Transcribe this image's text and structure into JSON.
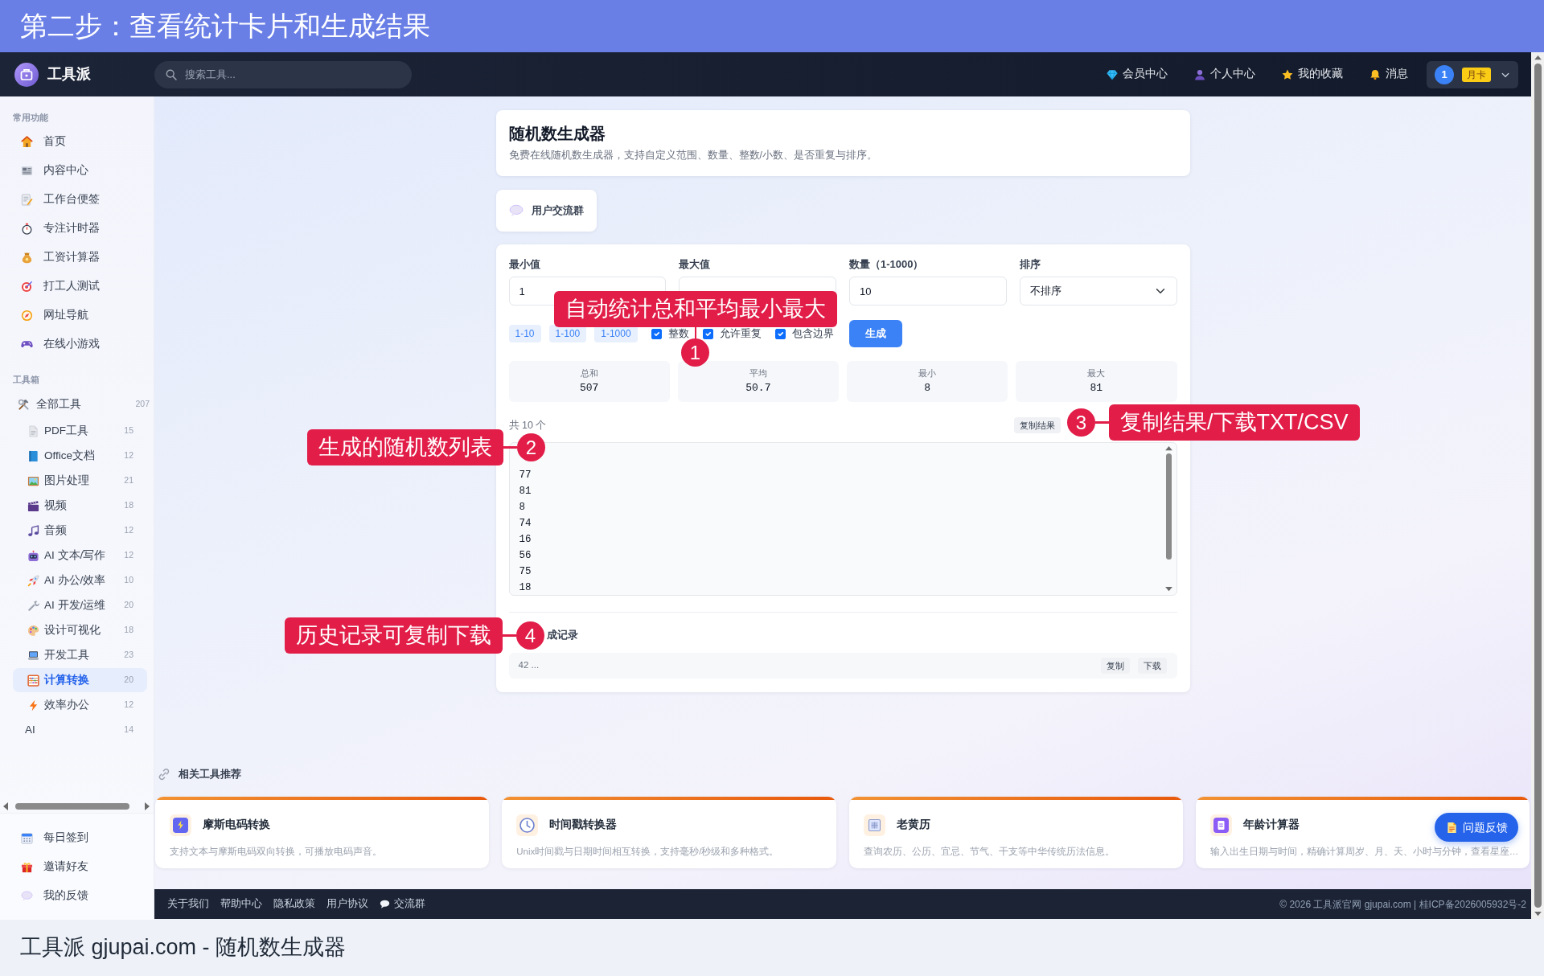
{
  "banner": {
    "title": "第二步：查看统计卡片和生成结果"
  },
  "navbar": {
    "brand": "工具派",
    "search": {
      "placeholder": "搜索工具..."
    },
    "links": [
      "会员中心",
      "个人中心",
      "我的收藏",
      "消息"
    ],
    "user": {
      "avatar": "1",
      "badge": "月卡"
    }
  },
  "sidebar": {
    "sections": [
      {
        "title": "常用功能",
        "items": [
          {
            "label": "首页",
            "selected": false
          },
          {
            "label": "内容中心",
            "selected": false
          },
          {
            "label": "工作台便签",
            "selected": false
          },
          {
            "label": "专注计时器",
            "selected": false
          },
          {
            "label": "工资计算器",
            "selected": false
          },
          {
            "label": "打工人测试",
            "selected": false
          },
          {
            "label": "网址导航",
            "selected": false
          },
          {
            "label": "在线小游戏",
            "selected": false
          }
        ]
      },
      {
        "title": "工具箱",
        "items": [
          {
            "label": "全部工具",
            "count": "207",
            "selected": false,
            "children": [
              {
                "label": "PDF工具",
                "count": "15",
                "selected": false
              },
              {
                "label": "Office文档",
                "count": "12",
                "selected": false
              },
              {
                "label": "图片处理",
                "count": "21",
                "selected": false
              },
              {
                "label": "视频",
                "count": "18",
                "selected": false
              },
              {
                "label": "音频",
                "count": "12",
                "selected": false
              },
              {
                "label": "AI 文本/写作",
                "count": "12",
                "selected": false
              },
              {
                "label": "AI 办公/效率",
                "count": "10",
                "selected": false
              },
              {
                "label": "AI 开发/运维",
                "count": "20",
                "selected": false
              },
              {
                "label": "设计可视化",
                "count": "18",
                "selected": false
              },
              {
                "label": "开发工具",
                "count": "23",
                "selected": false
              },
              {
                "label": "计算转换",
                "count": "20",
                "selected": true
              },
              {
                "label": "效率办公",
                "count": "12",
                "selected": false
              },
              {
                "label": "AI",
                "count": "14",
                "selected": false
              }
            ]
          }
        ]
      }
    ],
    "footer_items": [
      {
        "label": "每日签到",
        "selected": false
      },
      {
        "label": "邀请好友",
        "selected": false
      },
      {
        "label": "我的反馈",
        "selected": false
      }
    ]
  },
  "tool": {
    "title": "随机数生成器",
    "description": "免费在线随机数生成器，支持自定义范围、数量、整数/小数、是否重复与排序。"
  },
  "community": {
    "label": "用户交流群"
  },
  "form": {
    "fields": [
      {
        "label": "最小值",
        "kind": "input",
        "value": "1"
      },
      {
        "label": "最大值",
        "kind": "input"
      },
      {
        "label": "数量（1-1000）",
        "kind": "input",
        "value": "10"
      },
      {
        "label": "排序",
        "kind": "select",
        "value": "不排序"
      }
    ],
    "presets": [
      "1-10",
      "1-100",
      "1-1000"
    ],
    "options": [
      {
        "label": "整数",
        "checked": true
      },
      {
        "label": "允许重复",
        "checked": true
      },
      {
        "label": "包含边界",
        "checked": true
      }
    ],
    "submit": "生成"
  },
  "stats": [
    {
      "label": "总和",
      "value": "507"
    },
    {
      "label": "平均",
      "value": "50.7"
    },
    {
      "label": "最小",
      "value": "8"
    },
    {
      "label": "最大",
      "value": "81"
    }
  ],
  "results": {
    "summary": "共 10 个",
    "actions": [
      "复制结果"
    ],
    "values": [
      "77",
      "81",
      "8",
      "74",
      "16",
      "56",
      "75",
      "18"
    ]
  },
  "history": {
    "title": "成记录",
    "entries": [
      {
        "text": "42 ...",
        "actions": [
          "复制",
          "下载"
        ]
      }
    ]
  },
  "related": {
    "title": "相关工具推荐",
    "cards": [
      {
        "title": "摩斯电码转换",
        "description": "支持文本与摩斯电码双向转换，可播放电码声音。"
      },
      {
        "title": "时间戳转换器",
        "description": "Unix时间戳与日期时间相互转换，支持毫秒/秒级和多种格式。"
      },
      {
        "title": "老黄历",
        "description": "查询农历、公历、宜忌、节气、干支等中华传统历法信息。"
      },
      {
        "title": "年龄计算器",
        "description": "输入出生日期与时间，精确计算周岁、月、天、小时与分钟，查看星座…"
      }
    ]
  },
  "feedback_button": "问题反馈",
  "footer": {
    "links": [
      "关于我们",
      "帮助中心",
      "隐私政策",
      "用户协议",
      "交流群"
    ],
    "copyright": "© 2026 工具派官网 gjupai.com | 桂ICP备2026005932号-2"
  },
  "callouts": [
    {
      "number": "1",
      "text": "自动统计总和平均最小最大"
    },
    {
      "number": "2",
      "text": "生成的随机数列表"
    },
    {
      "number": "3",
      "text": "复制结果/下载TXT/CSV"
    },
    {
      "number": "4",
      "text": "历史记录可复制下载"
    }
  ],
  "caption": "工具派 gjupai.com - 随机数生成器"
}
